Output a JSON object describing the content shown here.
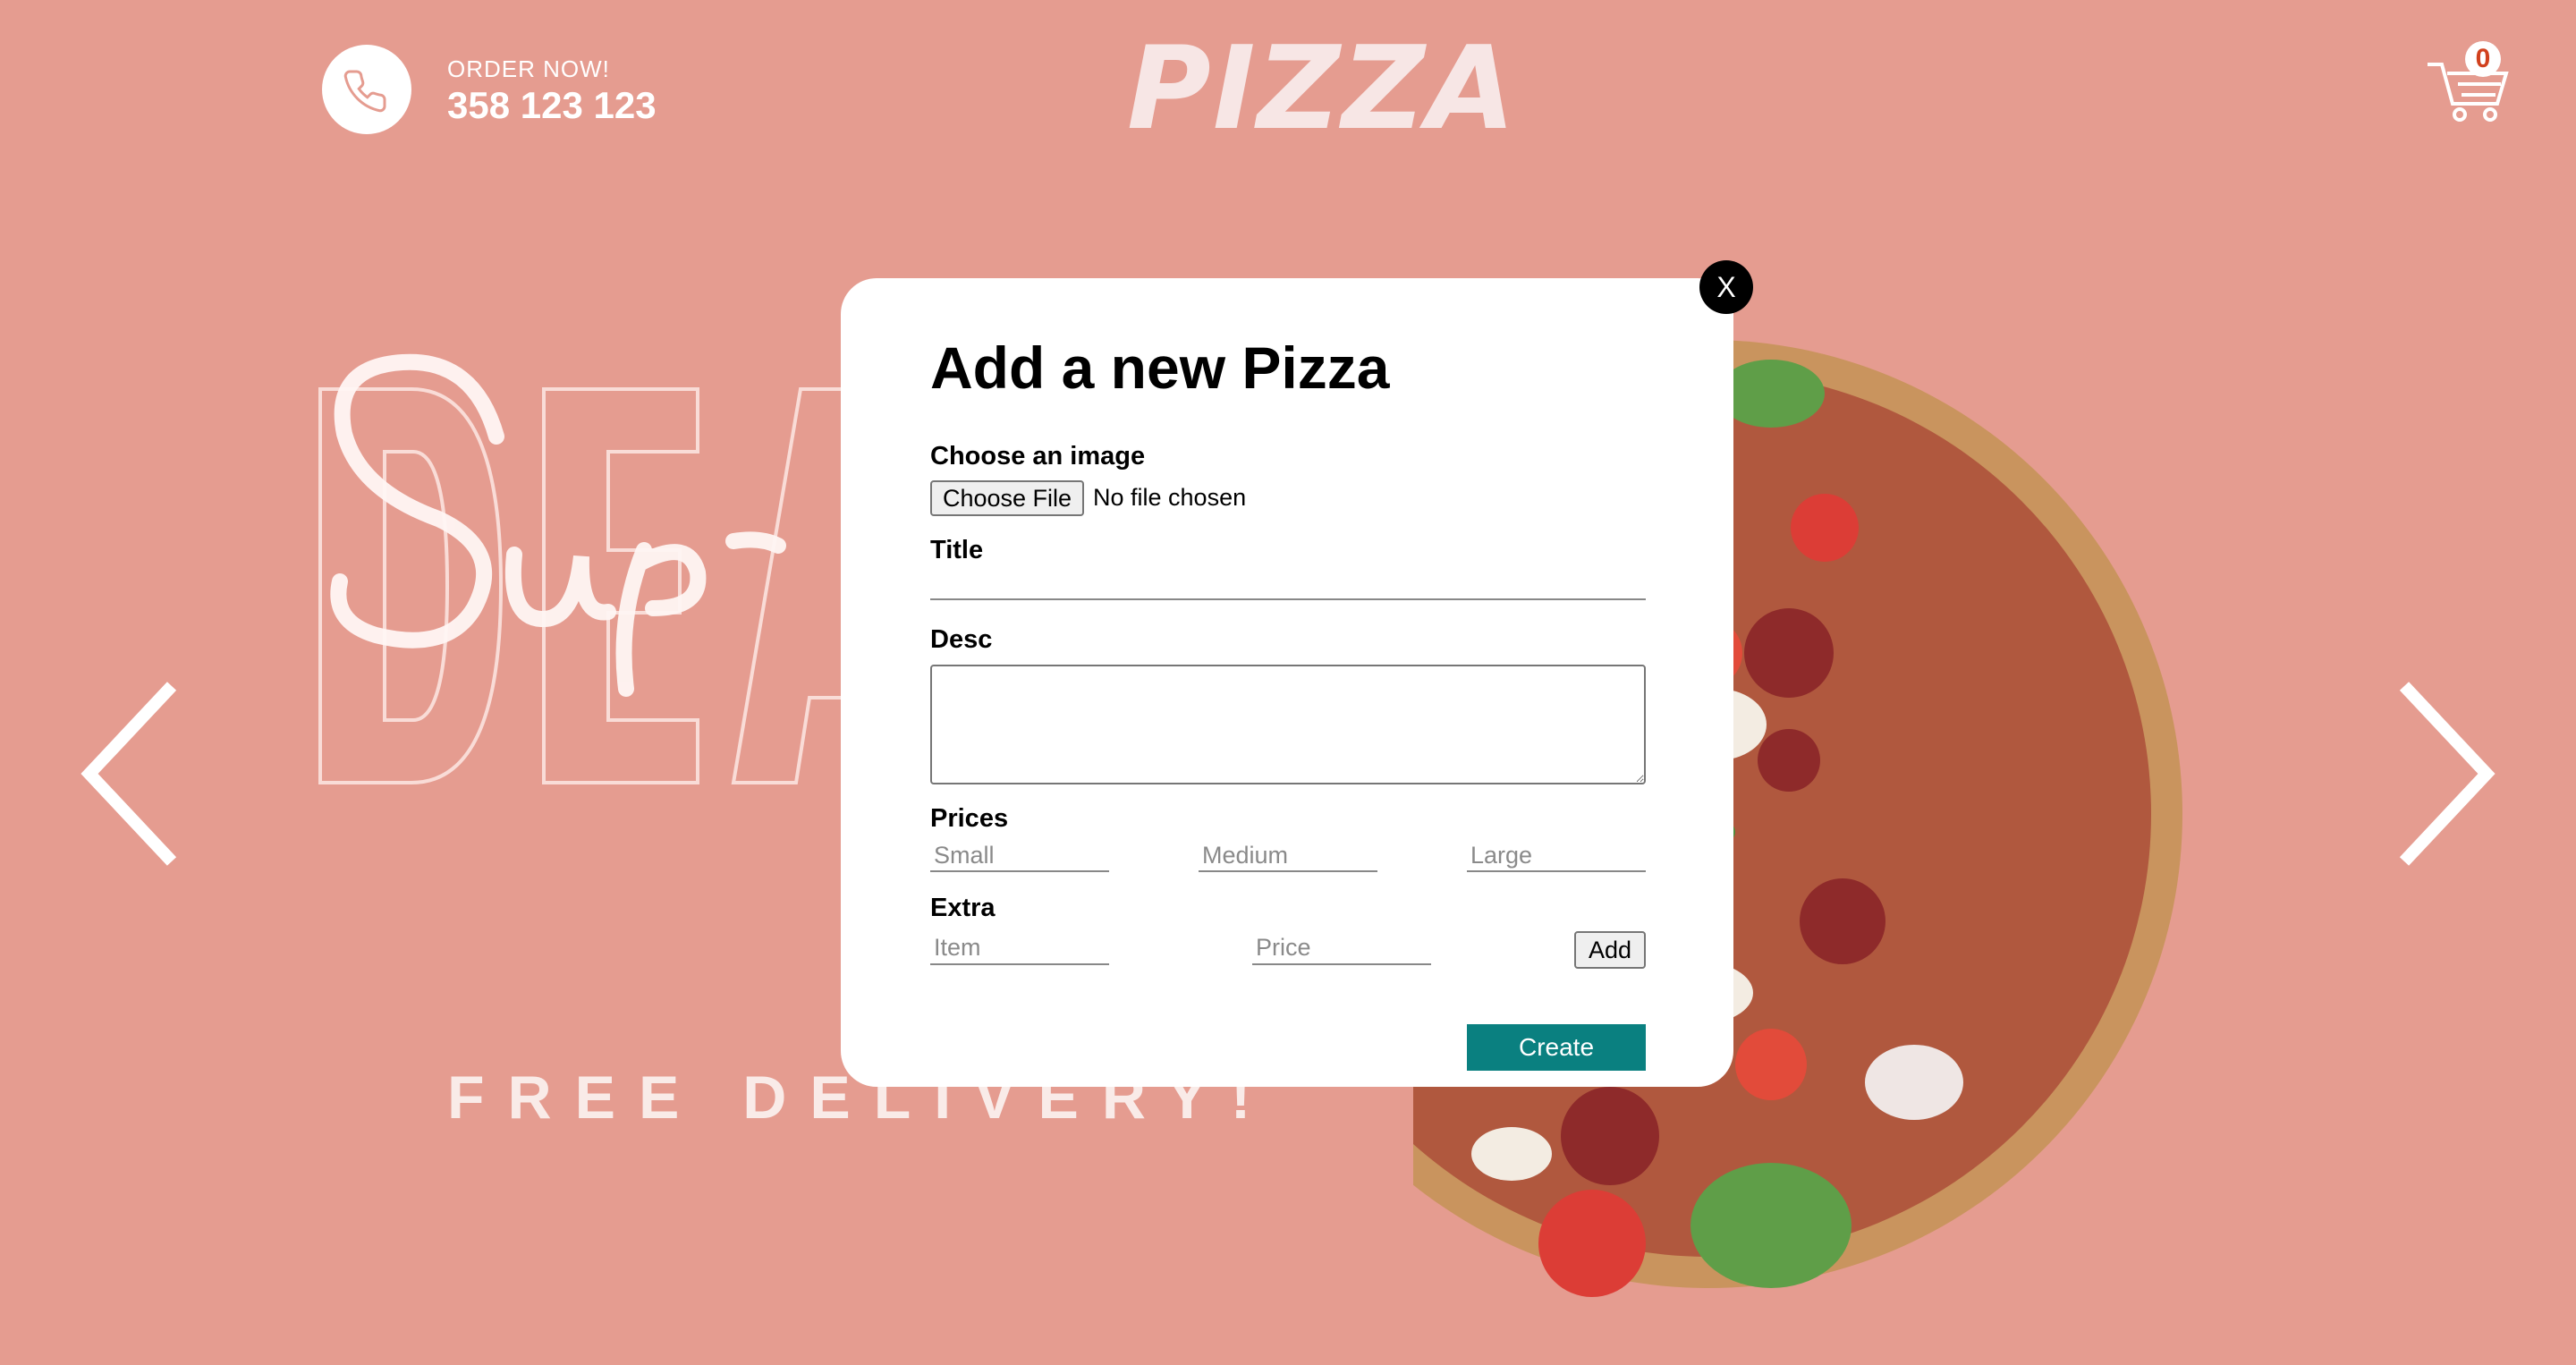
{
  "navbar": {
    "order_label": "ORDER NOW!",
    "phone": "358 123 123",
    "logo_text": "PIZZA",
    "cart_count": "0"
  },
  "hero": {
    "tagline": "FREE DELIVERY!",
    "left_arrow_icon": "chevron-left-icon",
    "right_arrow_icon": "chevron-right-icon"
  },
  "modal": {
    "close_label": "X",
    "title": "Add a new Pizza",
    "image_label": "Choose an image",
    "file_button": "Choose File",
    "file_status": "No file chosen",
    "title_label": "Title",
    "title_value": "",
    "desc_label": "Desc",
    "desc_value": "",
    "prices_label": "Prices",
    "price_placeholders": {
      "small": "Small",
      "medium": "Medium",
      "large": "Large"
    },
    "extra_label": "Extra",
    "extra_placeholders": {
      "item": "Item",
      "price": "Price"
    },
    "add_button": "Add",
    "create_button": "Create"
  },
  "colors": {
    "background": "#e59c90",
    "modal_background": "#ffffff",
    "create_button": "#0a8080",
    "close_button": "#000000"
  }
}
